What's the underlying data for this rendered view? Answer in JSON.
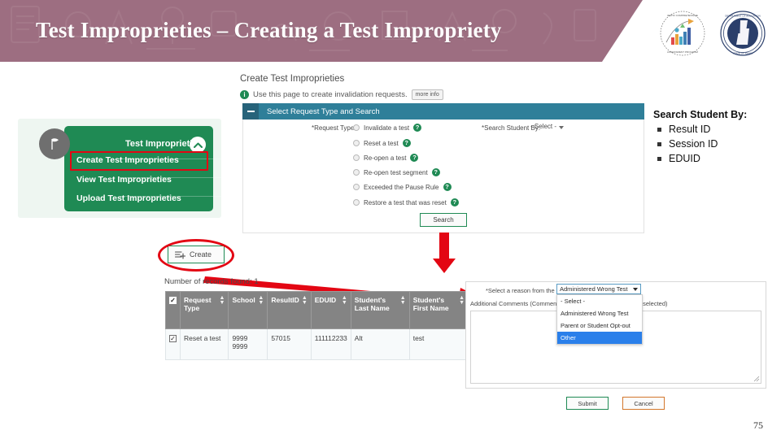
{
  "header": {
    "title": "Test Improprieties – Creating a Test Impropriety",
    "banner_color": "#9d6e81",
    "logos": [
      {
        "name": "idaho-comprehensive-assessment-program-logo",
        "alt": "Idaho Comprehensive Assessment Program"
      },
      {
        "name": "idaho-state-department-of-education-seal",
        "alt": "State Department of Education Idaho"
      }
    ]
  },
  "green_menu": {
    "icon": "flag-gear-icon",
    "header_label": "Test Improprieties",
    "collapse_icon": "chevron-up-icon",
    "items": [
      {
        "label": "Create Test Improprieties",
        "highlighted": true
      },
      {
        "label": "View Test Improprieties",
        "highlighted": false
      },
      {
        "label": "Upload Test Improprieties",
        "highlighted": false
      }
    ],
    "panel_color": "#1f8a54",
    "highlight_color": "#e30613"
  },
  "app": {
    "page_title": "Create Test Improprieties",
    "info_icon": "info-icon",
    "subtitle": "Use this page to create invalidation requests.",
    "more_info_label": "more info",
    "section": {
      "collapse_icon": "minus-icon",
      "header": "Select Request Type and Search",
      "header_color": "#2f7f99"
    },
    "request_type_label": "*Request Type:",
    "request_types": [
      {
        "label": "Invalidate a test",
        "help": "?"
      },
      {
        "label": "Reset a test",
        "help": "?"
      },
      {
        "label": "Re-open a test",
        "help": "?"
      },
      {
        "label": "Re-open test segment",
        "help": "?"
      },
      {
        "label": "Exceeded the Pause Rule",
        "help": "?"
      },
      {
        "label": "Restore a test that was reset",
        "help": "?"
      }
    ],
    "search_student_by_label": "*Search Student By:",
    "search_student_by_value": "- Select -",
    "search_button_label": "Search",
    "create_button_label": "Create",
    "create_button_icon": "list-plus-icon",
    "records_found": "Number of records found: 1",
    "table": {
      "columns": [
        "Request Type",
        "School",
        "ResultID",
        "EDUID",
        "Student's Last Name",
        "Student's First Name"
      ],
      "rows": [
        {
          "selected": true,
          "cells": [
            "Reset a test",
            "9999 9999",
            "57015",
            "111112233",
            "Alt",
            "test"
          ]
        }
      ]
    },
    "reason": {
      "label": "*Select a reason from the list:",
      "selected_value": "Administered Wrong Test",
      "options": [
        {
          "label": "- Select -",
          "selected": false
        },
        {
          "label": "Administered Wrong Test",
          "selected": false
        },
        {
          "label": "Parent or Student Opt-out",
          "selected": false
        },
        {
          "label": "Other",
          "selected": true
        }
      ],
      "comments_label_start": "Additional Comments (Comment",
      "comments_label_end": "is selected)",
      "comments_value": ""
    },
    "submit_label": "Submit",
    "cancel_label": "Cancel"
  },
  "annotation": {
    "note_title": "Search Student By:",
    "note_items": [
      "Result ID",
      "Session ID",
      "EDUID"
    ],
    "arrow_color": "#e30613"
  },
  "page_number": "75"
}
